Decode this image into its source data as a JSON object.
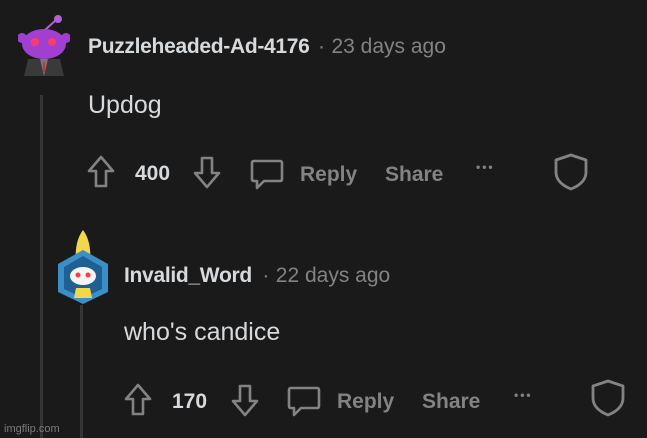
{
  "comments": [
    {
      "username": "Puzzleheaded-Ad-4176",
      "separator": "·",
      "time": "23 days ago",
      "body": "Updog",
      "votes": "400",
      "reply_label": "Reply",
      "share_label": "Share",
      "more_label": "•••"
    },
    {
      "username": "Invalid_Word",
      "separator": "·",
      "time": "22 days ago",
      "body": "who's candice",
      "votes": "170",
      "reply_label": "Reply",
      "share_label": "Share",
      "more_label": "•••"
    }
  ],
  "watermark": "imgflip.com",
  "colors": {
    "background": "#1a1a1b",
    "text": "#d7dadc",
    "muted": "#818384",
    "avatar_purple": "#8a2be2"
  }
}
